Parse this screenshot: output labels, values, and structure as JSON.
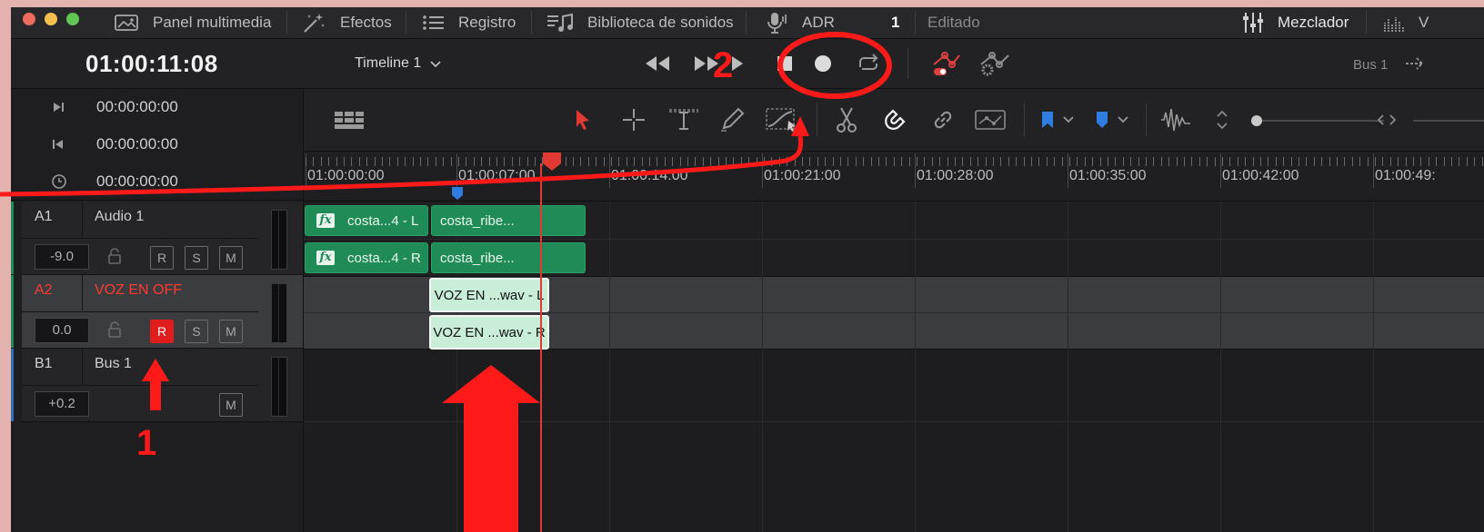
{
  "menubar": {
    "items": [
      {
        "label": "Panel multimedia",
        "icon": "media-panel-icon"
      },
      {
        "label": "Efectos",
        "icon": "effects-wand-icon"
      },
      {
        "label": "Registro",
        "icon": "list-icon"
      },
      {
        "label": "Biblioteca de sonidos",
        "icon": "music-library-icon"
      },
      {
        "label": "ADR",
        "icon": "microphone-icon"
      }
    ],
    "edit_count": "1",
    "edit_status": "Editado",
    "mixer_label": "Mezclador",
    "cut_letter": "V"
  },
  "transport": {
    "timecode": "01:00:11:08",
    "timeline_name": "Timeline 1",
    "bus_label": "Bus 1"
  },
  "timecodes": [
    {
      "icon": "in-point-icon",
      "value": "00:00:00:00"
    },
    {
      "icon": "out-point-icon",
      "value": "00:00:00:00"
    },
    {
      "icon": "clock-icon",
      "value": "00:00:00:00"
    }
  ],
  "tracks": [
    {
      "id": "A1",
      "name": "Audio 1",
      "volume": "-9.0",
      "record": "R",
      "solo": "S",
      "mute": "M",
      "armed": false
    },
    {
      "id": "A2",
      "name": "VOZ EN OFF",
      "volume": "0.0",
      "record": "R",
      "solo": "S",
      "mute": "M",
      "armed": true
    },
    {
      "id": "B1",
      "name": "Bus 1",
      "volume": "+0.2",
      "mute": "M"
    }
  ],
  "ruler": {
    "labels": [
      "01:00:00:00",
      "01:00:07:00",
      "01:00:14:00",
      "01:00:21:00",
      "01:00:28:00",
      "01:00:35:00",
      "01:00:42:00",
      "01:00:49:"
    ]
  },
  "clips": {
    "a1_left_1": "costa...4 - L",
    "a1_left_2": "costa_ribe...",
    "a1_right_1": "costa...4 - R",
    "a1_right_2": "costa_ribe...",
    "a2_left": "VOZ EN ...wav - L",
    "a2_right": "VOZ EN ...wav - R"
  },
  "annotations": {
    "one": "1",
    "two": "2"
  },
  "colors": {
    "record_active": "#e01d1d",
    "clip_green": "#1f8b57",
    "clip_light": "#c9eed8",
    "annotation_red": "#ff1a1a",
    "playhead": "#e23a33"
  }
}
